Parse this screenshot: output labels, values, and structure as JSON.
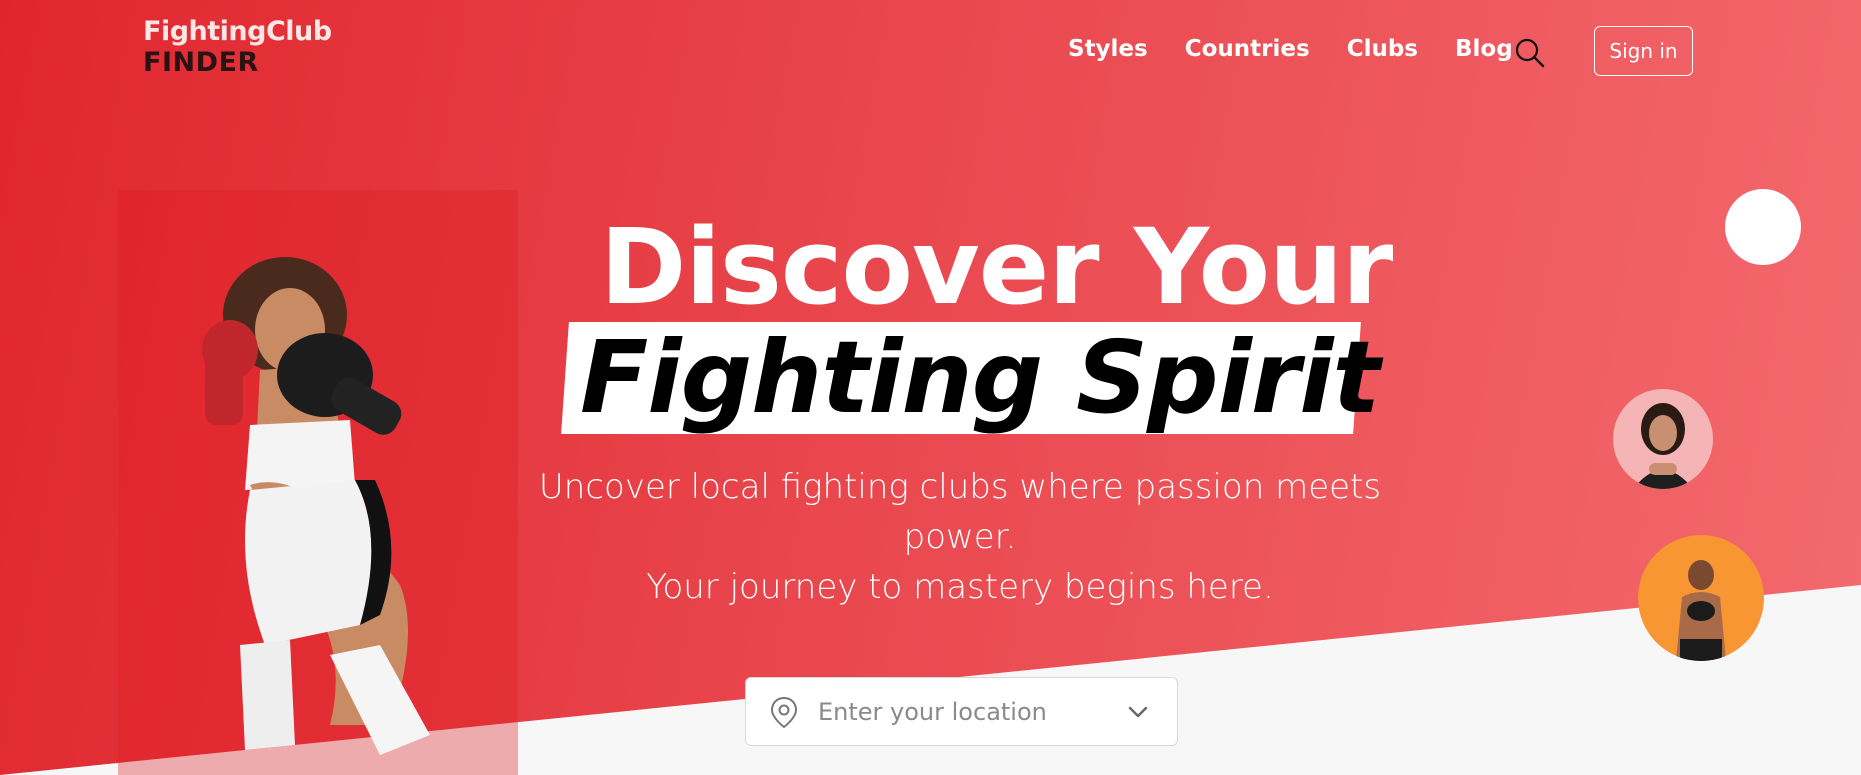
{
  "brand": {
    "line1": "FightingClub",
    "line2": "FINDER"
  },
  "nav": {
    "items": [
      "Styles",
      "Countries",
      "Clubs",
      "Blog"
    ],
    "sign_in": "Sign in"
  },
  "hero": {
    "title_line1": "Discover Your",
    "title_line2": "Fighting Spirit",
    "subtitle_line1": "Uncover local fighting clubs where passion meets power.",
    "subtitle_line2": "Your journey to mastery begins here."
  },
  "search": {
    "placeholder": "Enter your location"
  },
  "colors": {
    "accent": "#e0262d",
    "accent_light": "#f36a6e",
    "avatar1_bg": "#f5b5b7",
    "avatar2_bg": "#f79632"
  },
  "icons": {
    "search": "search-icon",
    "location": "location-pin-icon",
    "dropdown": "chevron-down-icon"
  }
}
